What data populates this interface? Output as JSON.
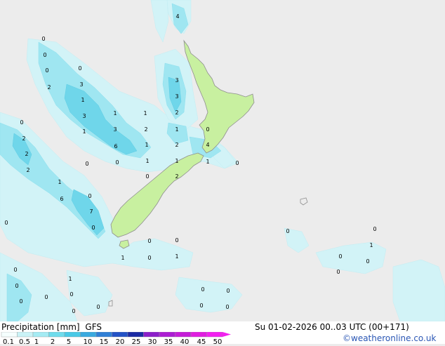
{
  "title": "Precipitation [mm]",
  "model": "GFS",
  "valid_time": "Su 01-02-2026 00..03 UTC (00+171)",
  "copyright": "©weatheronline.co.uk",
  "legend": {
    "ticks": [
      "0.1",
      "0.5",
      "1",
      "2",
      "5",
      "10",
      "15",
      "20",
      "25",
      "30",
      "35",
      "40",
      "45",
      "50"
    ],
    "colors": [
      "#f5fffe",
      "#c9f2f6",
      "#a4ebf3",
      "#6fdcec",
      "#49c9e6",
      "#3aa9df",
      "#2f7fd6",
      "#2352c6",
      "#1a2aa3",
      "#8c1fc9",
      "#ac1dd3",
      "#c51cd8",
      "#e01ee0",
      "#f21ff0"
    ]
  },
  "map_labels": [
    {
      "name": "label-4-top",
      "text": "4"
    },
    {
      "name": "label-0-nw",
      "text": "0"
    },
    {
      "name": "label-0-nw2",
      "text": "0"
    },
    {
      "name": "label-0-nw3",
      "text": "0"
    },
    {
      "name": "label-0-north-island-n",
      "text": "0"
    },
    {
      "name": "label-3-a",
      "text": "3"
    },
    {
      "name": "label-2-a",
      "text": "2"
    },
    {
      "name": "label-3-b",
      "text": "3"
    },
    {
      "name": "label-3-c",
      "text": "3"
    },
    {
      "name": "label-1-a",
      "text": "1"
    },
    {
      "name": "label-3-d",
      "text": "3"
    },
    {
      "name": "label-1-b",
      "text": "1"
    },
    {
      "name": "label-1-c",
      "text": "1"
    },
    {
      "name": "label-2-b",
      "text": "2"
    },
    {
      "name": "label-0-w",
      "text": "0"
    },
    {
      "name": "label-1-d",
      "text": "1"
    },
    {
      "name": "label-3-e",
      "text": "3"
    },
    {
      "name": "label-2-c",
      "text": "2"
    },
    {
      "name": "label-1-e",
      "text": "1"
    },
    {
      "name": "label-0-east",
      "text": "0"
    },
    {
      "name": "label-2-d",
      "text": "2"
    },
    {
      "name": "label-2-e",
      "text": "2"
    },
    {
      "name": "label-6-a",
      "text": "6"
    },
    {
      "name": "label-1-f",
      "text": "1"
    },
    {
      "name": "label-2-f",
      "text": "2"
    },
    {
      "name": "label-4-wellington",
      "text": "4"
    },
    {
      "name": "label-2-g",
      "text": "2"
    },
    {
      "name": "label-0-b",
      "text": "0"
    },
    {
      "name": "label-0-c",
      "text": "0"
    },
    {
      "name": "label-1-g",
      "text": "1"
    },
    {
      "name": "label-1-h",
      "text": "1"
    },
    {
      "name": "label-1-i",
      "text": "1"
    },
    {
      "name": "label-0-d",
      "text": "0"
    },
    {
      "name": "label-1-j",
      "text": "1"
    },
    {
      "name": "label-0-e",
      "text": "0"
    },
    {
      "name": "label-0-f",
      "text": "0"
    },
    {
      "name": "label-2-h",
      "text": "2"
    },
    {
      "name": "label-6-b",
      "text": "6"
    },
    {
      "name": "label-7-a",
      "text": "7"
    },
    {
      "name": "label-0-g",
      "text": "0"
    },
    {
      "name": "label-0-h",
      "text": "0"
    },
    {
      "name": "label-0-i",
      "text": "0"
    },
    {
      "name": "label-0-j",
      "text": "0"
    },
    {
      "name": "label-1-k",
      "text": "1"
    },
    {
      "name": "label-0-k",
      "text": "0"
    },
    {
      "name": "label-1-l",
      "text": "1"
    },
    {
      "name": "label-0-l",
      "text": "0"
    },
    {
      "name": "label-1-m",
      "text": "1"
    },
    {
      "name": "label-0-m",
      "text": "0"
    },
    {
      "name": "label-0-n",
      "text": "0"
    },
    {
      "name": "label-0-o",
      "text": "0"
    },
    {
      "name": "label-0-p",
      "text": "0"
    },
    {
      "name": "label-0-q",
      "text": "0"
    },
    {
      "name": "label-0-r",
      "text": "0"
    },
    {
      "name": "label-0-s",
      "text": "0"
    },
    {
      "name": "label-0-t",
      "text": "0"
    },
    {
      "name": "label-0-u",
      "text": "0"
    },
    {
      "name": "label-0-v",
      "text": "0"
    },
    {
      "name": "label-0-w2",
      "text": "0"
    },
    {
      "name": "label-0-x",
      "text": "0"
    },
    {
      "name": "label-1-n",
      "text": "1"
    },
    {
      "name": "label-0-y",
      "text": "0"
    },
    {
      "name": "label-0-z",
      "text": "0"
    },
    {
      "name": "label-0-aa",
      "text": "0"
    }
  ]
}
